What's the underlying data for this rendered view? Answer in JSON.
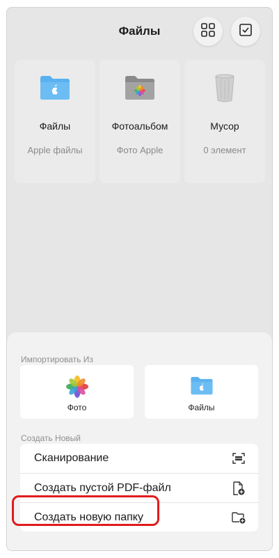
{
  "header": {
    "title": "Файлы",
    "grid_icon": "grid-icon",
    "select_icon": "checkbox-icon"
  },
  "locations": [
    {
      "name": "Файлы",
      "sub": "Apple файлы",
      "icon": "blue-folder-icon"
    },
    {
      "name": "Фотоальбом",
      "sub": "Фото Apple",
      "icon": "photos-folder-icon"
    },
    {
      "name": "Мусор",
      "sub": "0 элемент",
      "icon": "trash-icon"
    }
  ],
  "sheet": {
    "import_label": "Импортировать Из",
    "import_items": [
      {
        "label": "Фото",
        "icon": "photos-icon"
      },
      {
        "label": "Файлы",
        "icon": "folder-icon"
      }
    ],
    "create_label": "Создать Новый",
    "create_items": [
      {
        "label": "Сканирование",
        "icon": "scan-icon"
      },
      {
        "label": "Создать пустой PDF-файл",
        "icon": "new-pdf-icon"
      },
      {
        "label": "Создать новую папку",
        "icon": "new-folder-icon"
      }
    ]
  },
  "colors": {
    "highlight": "#e21b1b",
    "folder": "#5ab1ef"
  }
}
